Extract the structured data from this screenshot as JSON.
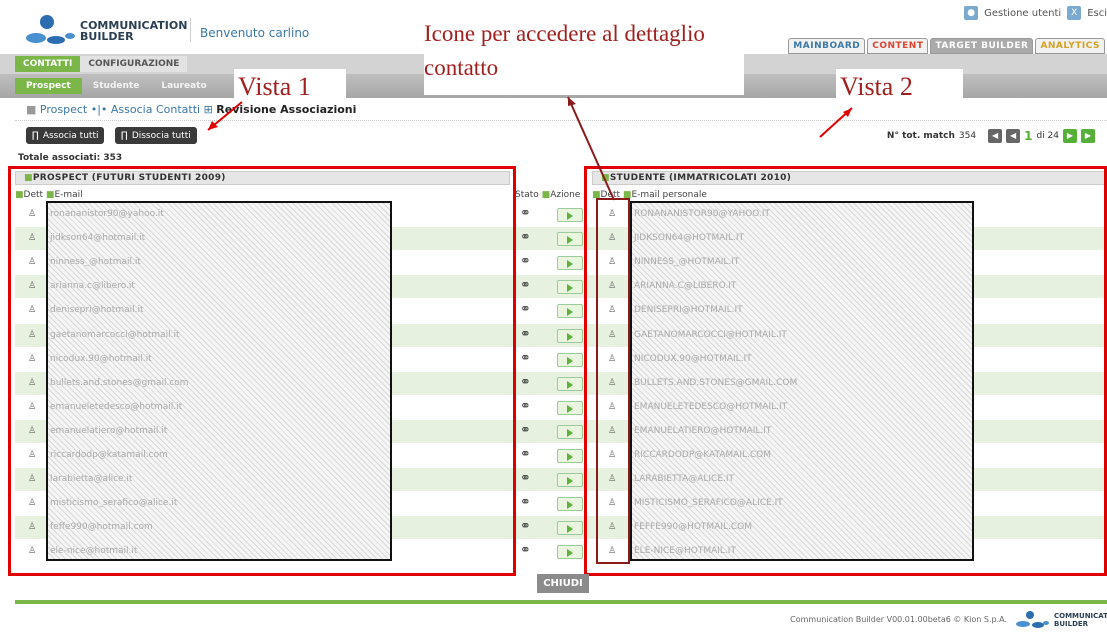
{
  "header": {
    "logo_text": "COMMUNICATION BUILDER",
    "welcome": "Benvenuto carlino",
    "user_mgmt": "Gestione utenti",
    "exit": "Esci"
  },
  "modules": [
    "MAINBOARD",
    "CONTENT",
    "TARGET BUILDER",
    "ANALYTICS"
  ],
  "tabs": [
    "CONTATTI",
    "CONFIGURAZIONE"
  ],
  "subtabs": [
    "Prospect",
    "Studente",
    "Laureato"
  ],
  "breadcrumb": {
    "a": "Prospect",
    "sep": "•|•",
    "b": "Associa Contatti",
    "c": "Revisione Associazioni"
  },
  "buttons": {
    "associa": "Associa tutti",
    "dissocia": "Dissocia tutti",
    "chiudi": "CHIUDI"
  },
  "pager": {
    "label": "N° tot. match",
    "total": "354",
    "page": "1",
    "of": "di 24"
  },
  "totale": "Totale associati: 353",
  "left_panel": {
    "title": "PROSPECT  (FUTURI STUDENTI 2009)",
    "col_dett": "Dett",
    "col_email": "E-mail",
    "emails": [
      "ronananistor90@yahoo.it",
      "jidkson64@hotmail.it",
      "ninness_@hotmail.it",
      "arianna.c@libero.it",
      "denisepri@hotmail.it",
      "gaetanomarcocci@hotmail.it",
      "nicodux.90@hotmail.it",
      "bullets.and.stones@gmail.com",
      "emanueletedesco@hotmail.it",
      "emanuelatiero@hotmail.it",
      "riccardodp@katamail.com",
      "larabietta@alice.it",
      "misticismo_serafico@alice.it",
      "feffe990@hotmail.com",
      "ele-nice@hotmail.it"
    ]
  },
  "mid_cols": {
    "stato": "Stato",
    "azione": "Azione"
  },
  "right_panel": {
    "title": "STUDENTE  (IMMATRICOLATI 2010)",
    "col_dett": "Dett",
    "col_email": "E-mail personale",
    "emails": [
      "RONANANISTOR90@YAHOO.IT",
      "JIDKSON64@HOTMAIL.IT",
      "NINNESS_@HOTMAIL.IT",
      "ARIANNA.C@LIBERO.IT",
      "DENISEPRI@HOTMAIL.IT",
      "GAETANOMARCOCCI@HOTMAIL.IT",
      "NICODUX.90@HOTMAIL.IT",
      "BULLETS.AND.STONES@GMAIL.COM",
      "EMANUELETEDESCO@HOTMAIL.IT",
      "EMANUELATIERO@HOTMAIL.IT",
      "RICCARDODP@KATAMAIL.COM",
      "LARABIETTA@ALICE.IT",
      "MISTICISMO_SERAFICO@ALICE.IT",
      "FEFFE990@HOTMAIL.COM",
      "ELE-NICE@HOTMAIL.IT"
    ]
  },
  "annotations": {
    "vista1": "Vista 1",
    "vista2": "Vista 2",
    "icone": "Icone per accedere al dettaglio contatto"
  },
  "footer": "Communication Builder V00.01.00beta6 © Kion S.p.A.",
  "colors": {
    "green": "#7ab648",
    "red": "#e00000",
    "callout": "#a02020"
  }
}
